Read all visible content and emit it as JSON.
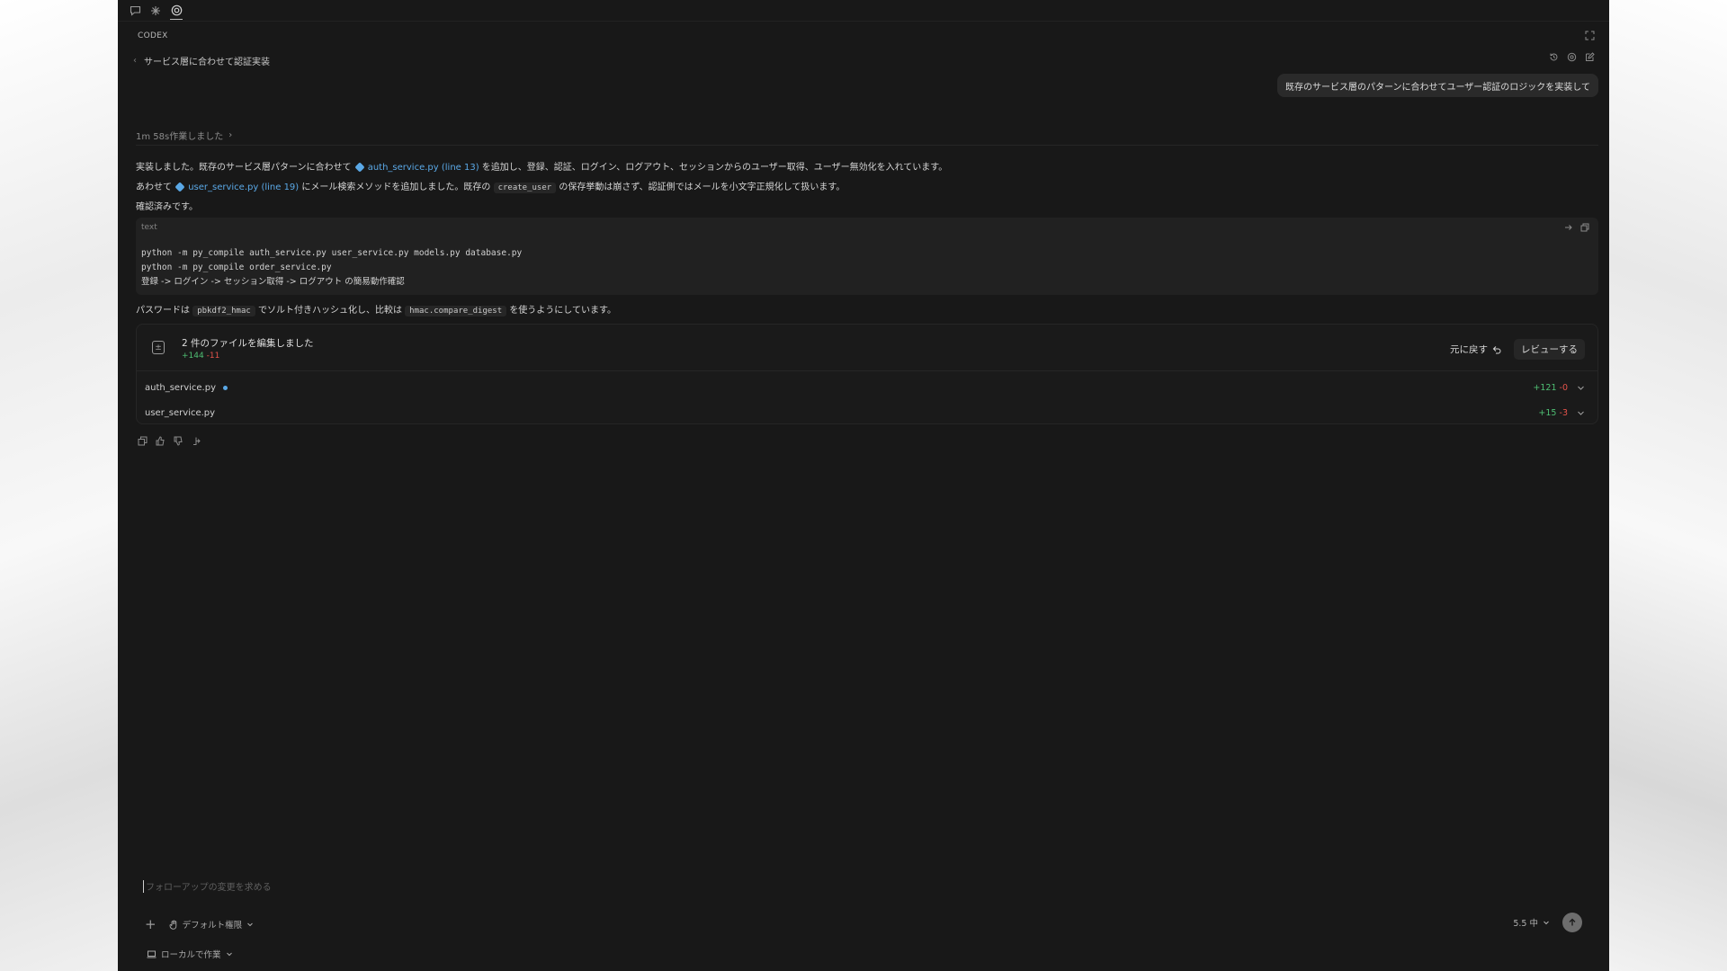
{
  "app": {
    "name": "CODEX",
    "thread_title": "サービス層に合わせて認証実装",
    "user_message": "既存のサービス層のパターンに合わせてユーザー認証のロジックを実装して"
  },
  "response": {
    "worked_label": "1m 58s作業しました",
    "line1_pre": "実装しました。既存のサービス層パターンに合わせて",
    "line1_link": "auth_service.py (line 13)",
    "line1_post": "を追加し、登録、認証、ログイン、ログアウト、セッションからのユーザー取得、ユーザー無効化を入れています。",
    "line2_pre": "あわせて",
    "line2_link": "user_service.py (line 19)",
    "line2_mid": "にメール検索メソッドを追加しました。既存の",
    "line2_code": "create_user",
    "line2_post": "の保存挙動は崩さず、認証側ではメールを小文字正規化して扱います。",
    "line3": "確認済みです。",
    "code_lang": "text",
    "code_lines": [
      "python -m py_compile auth_service.py user_service.py models.py database.py",
      "python -m py_compile order_service.py",
      "登録 -> ログイン -> セッション取得 -> ログアウト の簡易動作確認"
    ],
    "pw_pre": "パスワードは",
    "pw_code1": "pbkdf2_hmac",
    "pw_mid": "でソルト付きハッシュ化し、比較は",
    "pw_code2": "hmac.compare_digest",
    "pw_post": "を使うようにしています。"
  },
  "changes": {
    "title": "2 件のファイルを編集しました",
    "added": "+144",
    "removed": "-11",
    "undo_label": "元に戻す",
    "review_label": "レビューする",
    "files": [
      {
        "name": "auth_service.py",
        "added": "+121",
        "removed": "-0"
      },
      {
        "name": "user_service.py",
        "added": "+15",
        "removed": "-3"
      }
    ]
  },
  "composer": {
    "placeholder": "フォローアップの変更を求める",
    "permission": "デフォルト権限",
    "model": "5.5 中",
    "location": "ローカルで作業"
  },
  "colors": {
    "accent": "#5aa8e6",
    "added": "#4fbf73",
    "removed": "#e5534b",
    "panel": "#181818"
  }
}
